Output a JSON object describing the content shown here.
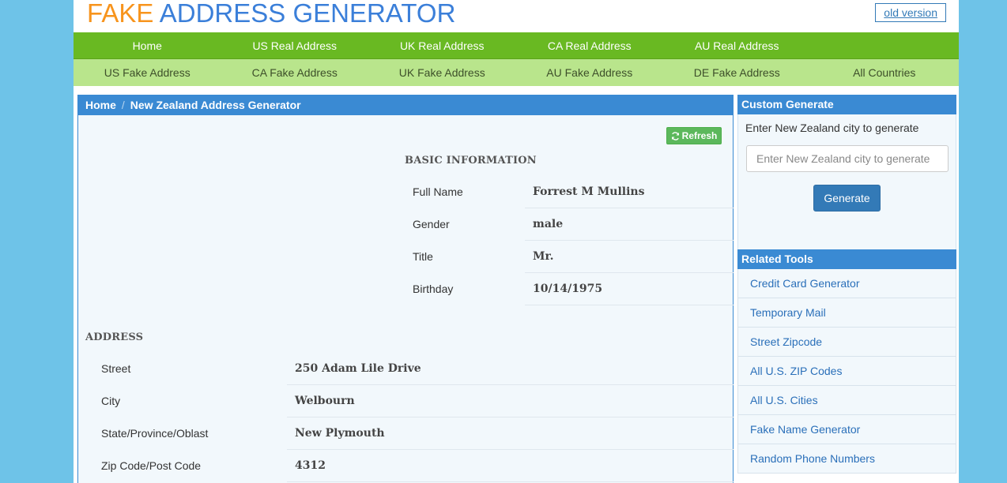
{
  "brand": {
    "title_a": "FAKE",
    "title_b": "ADDRESS GENERATOR",
    "old_version": "old version"
  },
  "nav_primary": [
    {
      "label": "Home"
    },
    {
      "label": "US Real Address"
    },
    {
      "label": "UK Real Address"
    },
    {
      "label": "CA Real Address"
    },
    {
      "label": "AU Real Address"
    },
    {
      "label": ""
    }
  ],
  "nav_secondary": [
    {
      "label": "US Fake Address"
    },
    {
      "label": "CA Fake Address"
    },
    {
      "label": "UK Fake Address"
    },
    {
      "label": "AU Fake Address"
    },
    {
      "label": "DE Fake Address"
    },
    {
      "label": "All Countries"
    }
  ],
  "breadcrumb": {
    "home": "Home",
    "separator": "/",
    "current": "New Zealand Address Generator"
  },
  "refresh_label": "Refresh",
  "basic": {
    "title": "BASIC INFORMATION",
    "rows": [
      {
        "label": "Full Name",
        "value": "Forrest M Mullins"
      },
      {
        "label": "Gender",
        "value": "male"
      },
      {
        "label": "Title",
        "value": "Mr."
      },
      {
        "label": "Birthday",
        "value": "10/14/1975"
      }
    ]
  },
  "address": {
    "title": "ADDRESS",
    "rows": [
      {
        "label": "Street",
        "value": "250 Adam Lile Drive"
      },
      {
        "label": "City",
        "value": "Welbourn"
      },
      {
        "label": "State/Province/Oblast",
        "value": "New Plymouth"
      },
      {
        "label": "Zip Code/Post Code",
        "value": "4312"
      }
    ]
  },
  "custom_generate": {
    "heading": "Custom Generate",
    "description": "Enter New Zealand city to generate",
    "placeholder": "Enter New Zealand city to generate",
    "button": "Generate"
  },
  "related_tools": {
    "heading": "Related Tools",
    "items": [
      {
        "label": "Credit Card Generator"
      },
      {
        "label": "Temporary Mail"
      },
      {
        "label": "Street Zipcode"
      },
      {
        "label": "All U.S. ZIP Codes"
      },
      {
        "label": "All U.S. Cities"
      },
      {
        "label": "Fake Name Generator"
      },
      {
        "label": "Random Phone Numbers"
      }
    ]
  },
  "colors": {
    "accent_blue": "#3a8ad3",
    "nav_green": "#69b922",
    "nav_light_green": "#b9e58c",
    "logo_orange": "#f7941d",
    "logo_blue": "#3b7fd9"
  }
}
